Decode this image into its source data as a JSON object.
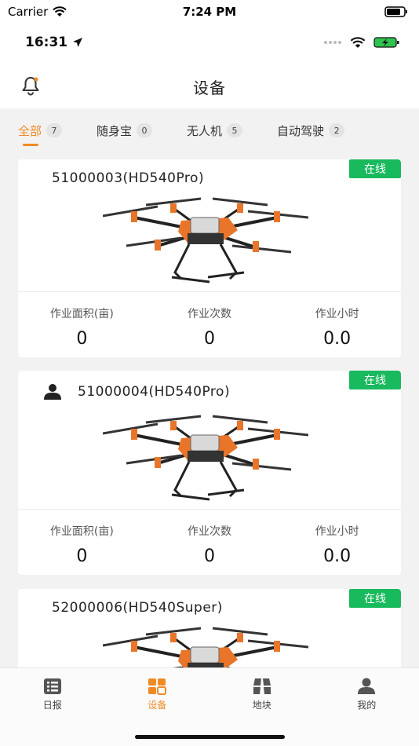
{
  "sim_status": {
    "carrier": "Carrier",
    "time": "7:24 PM"
  },
  "app_status": {
    "clock": "16:31"
  },
  "nav": {
    "title": "设备"
  },
  "tabs": [
    {
      "label": "全部",
      "count": "7",
      "active": true
    },
    {
      "label": "随身宝",
      "count": "0",
      "active": false
    },
    {
      "label": "无人机",
      "count": "5",
      "active": false
    },
    {
      "label": "自动驾驶",
      "count": "2",
      "active": false
    }
  ],
  "devices": [
    {
      "name": "51000003(HD540Pro)",
      "status": "在线",
      "has_user": false,
      "stats": [
        {
          "label": "作业面积(亩)",
          "value": "0"
        },
        {
          "label": "作业次数",
          "value": "0"
        },
        {
          "label": "作业小时",
          "value": "0.0"
        }
      ]
    },
    {
      "name": "51000004(HD540Pro)",
      "status": "在线",
      "has_user": true,
      "stats": [
        {
          "label": "作业面积(亩)",
          "value": "0"
        },
        {
          "label": "作业次数",
          "value": "0"
        },
        {
          "label": "作业小时",
          "value": "0.0"
        }
      ]
    },
    {
      "name": "52000006(HD540Super)",
      "status": "在线",
      "has_user": false,
      "stats": []
    }
  ],
  "bottom_nav": [
    {
      "label": "日报",
      "icon": "daily-report-icon",
      "active": false
    },
    {
      "label": "设备",
      "icon": "device-grid-icon",
      "active": true
    },
    {
      "label": "地块",
      "icon": "map-plot-icon",
      "active": false
    },
    {
      "label": "我的",
      "icon": "profile-icon",
      "active": false
    }
  ],
  "colors": {
    "accent": "#f08a24",
    "online": "#19b95e"
  }
}
